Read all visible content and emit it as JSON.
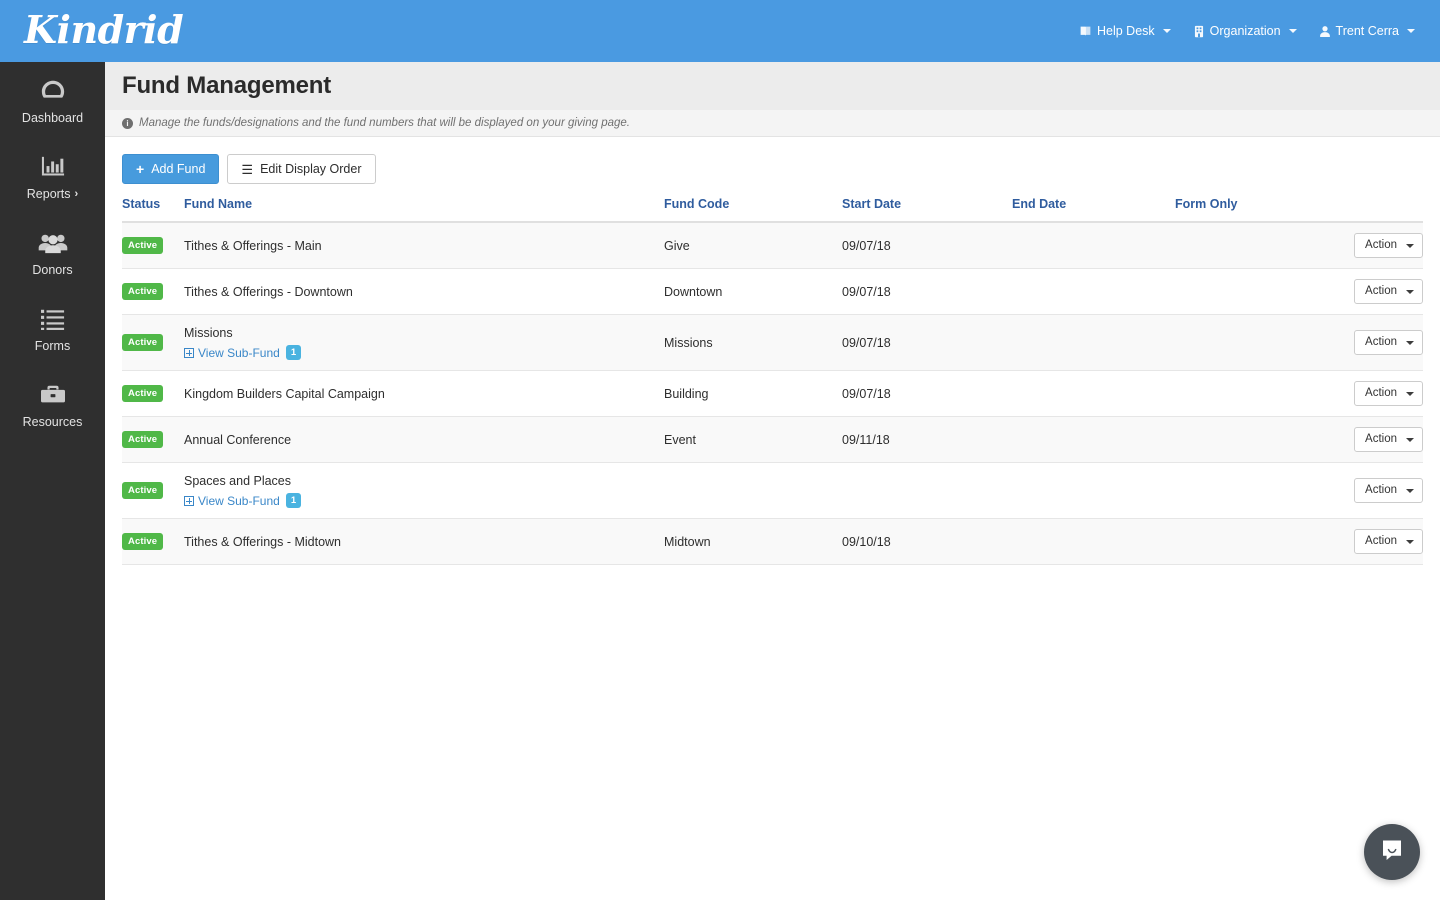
{
  "brand": {
    "logo_text": "Kindrid",
    "header_color": "#4a9ae1"
  },
  "topnav": {
    "items": [
      {
        "label": "Help Desk",
        "icon": "book-icon",
        "caret": true
      },
      {
        "label": "Organization",
        "icon": "building-icon",
        "caret": true
      },
      {
        "label": "Trent Cerra",
        "icon": "user-icon",
        "caret": true
      }
    ]
  },
  "sidebar": {
    "items": [
      {
        "label": "Dashboard",
        "icon": "gauge-icon",
        "chevron": ""
      },
      {
        "label": "Reports",
        "icon": "bar-chart-icon",
        "chevron": "›"
      },
      {
        "label": "Donors",
        "icon": "people-icon",
        "chevron": ""
      },
      {
        "label": "Forms",
        "icon": "list-icon",
        "chevron": ""
      },
      {
        "label": "Resources",
        "icon": "briefcase-icon",
        "chevron": ""
      }
    ]
  },
  "page": {
    "title": "Fund Management",
    "info_icon": "i",
    "info_text": "Manage the funds/designations and the fund numbers that will be displayed on your giving page."
  },
  "toolbar": {
    "add_fund_label": "Add Fund",
    "add_fund_icon": "+",
    "edit_order_label": "Edit Display Order",
    "edit_order_icon": "☰"
  },
  "table": {
    "headers": {
      "status": "Status",
      "fund_name": "Fund Name",
      "fund_code": "Fund Code",
      "start_date": "Start Date",
      "end_date": "End Date",
      "form_only": "Form Only",
      "action": ""
    },
    "subfund_link_label": "View Sub-Fund",
    "action_label": "Action",
    "rows": [
      {
        "status": "Active",
        "name": "Tithes & Offerings - Main",
        "code": "Give",
        "start_date": "09/07/18",
        "end_date": "",
        "form_only": "",
        "subfund_count": null
      },
      {
        "status": "Active",
        "name": "Tithes & Offerings - Downtown",
        "code": "Downtown",
        "start_date": "09/07/18",
        "end_date": "",
        "form_only": "",
        "subfund_count": null
      },
      {
        "status": "Active",
        "name": "Missions",
        "code": "Missions",
        "start_date": "09/07/18",
        "end_date": "",
        "form_only": "",
        "subfund_count": "1"
      },
      {
        "status": "Active",
        "name": "Kingdom Builders Capital Campaign",
        "code": "Building",
        "start_date": "09/07/18",
        "end_date": "",
        "form_only": "",
        "subfund_count": null
      },
      {
        "status": "Active",
        "name": "Annual Conference",
        "code": "Event",
        "start_date": "09/11/18",
        "end_date": "",
        "form_only": "",
        "subfund_count": null
      },
      {
        "status": "Active",
        "name": "Spaces and Places",
        "code": "",
        "start_date": "",
        "end_date": "",
        "form_only": "",
        "subfund_count": "1"
      },
      {
        "status": "Active",
        "name": "Tithes & Offerings - Midtown",
        "code": "Midtown",
        "start_date": "09/10/18",
        "end_date": "",
        "form_only": "",
        "subfund_count": null
      }
    ]
  },
  "chat": {
    "icon": "chat-bubble-icon"
  },
  "colors": {
    "accent_blue": "#4a9ae1",
    "primary_button": "#479bdd",
    "status_green": "#50b848",
    "badge_blue": "#4ab3e0",
    "header_text_blue": "#2f5c9e",
    "sidebar_dark": "#2f2f2f"
  }
}
